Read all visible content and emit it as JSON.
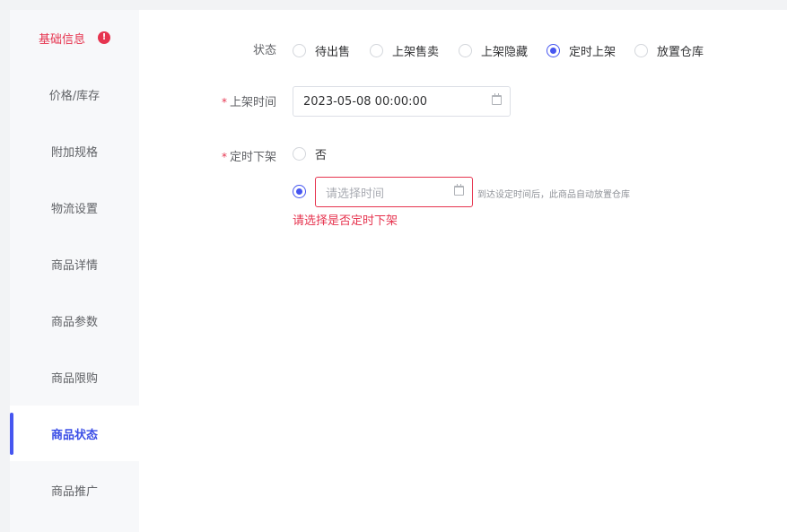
{
  "sidebar": {
    "items": [
      {
        "label": "基础信息",
        "state": "error",
        "badge": "!"
      },
      {
        "label": "价格/库存",
        "state": "normal"
      },
      {
        "label": "附加规格",
        "state": "normal"
      },
      {
        "label": "物流设置",
        "state": "normal"
      },
      {
        "label": "商品详情",
        "state": "normal"
      },
      {
        "label": "商品参数",
        "state": "normal"
      },
      {
        "label": "商品限购",
        "state": "normal"
      },
      {
        "label": "商品状态",
        "state": "active"
      },
      {
        "label": "商品推广",
        "state": "normal"
      }
    ]
  },
  "form": {
    "status": {
      "label": "状态",
      "options": [
        "待出售",
        "上架售卖",
        "上架隐藏",
        "定时上架",
        "放置仓库"
      ],
      "selected": "定时上架"
    },
    "shelf_time": {
      "required_mark": "*",
      "label": "上架时间",
      "value": "2023-05-08 00:00:00"
    },
    "scheduled_off": {
      "required_mark": "*",
      "label": "定时下架",
      "option_no": "否",
      "placeholder": "请选择时间",
      "hint": "到达设定时间后，此商品自动放置仓库",
      "error": "请选择是否定时下架"
    }
  },
  "colors": {
    "accent": "#4656f0",
    "error": "#e6344f"
  }
}
